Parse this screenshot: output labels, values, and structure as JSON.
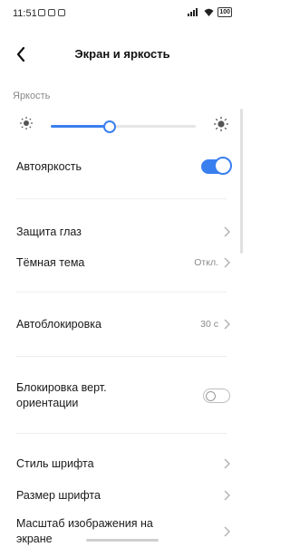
{
  "status_bar": {
    "time": "11:51",
    "battery": "100",
    "icons": [
      "notification-icon",
      "notification-icon",
      "notification-icon",
      "signal-icon",
      "wifi-icon",
      "battery-icon"
    ]
  },
  "header": {
    "title": "Экран и яркость",
    "back_icon": "back-arrow-icon"
  },
  "brightness": {
    "section_label": "Яркость",
    "level_percent": 40
  },
  "items": {
    "auto_brightness": {
      "label": "Автояркость",
      "on": true
    },
    "eye_protection": {
      "label": "Защита глаз"
    },
    "dark_theme": {
      "label": "Тёмная тема",
      "value": "Откл."
    },
    "auto_lock": {
      "label": "Автоблокировка",
      "value": "30 с"
    },
    "rotation_lock": {
      "label_line1": "Блокировка верт.",
      "label_line2": "ориентации",
      "on": false
    },
    "font_style": {
      "label": "Стиль шрифта"
    },
    "font_size": {
      "label": "Размер шрифта"
    },
    "display_scale": {
      "label_line1": "Масштаб изображения на",
      "label_line2": "экране"
    }
  },
  "colors": {
    "accent": "#3a7ff0"
  }
}
